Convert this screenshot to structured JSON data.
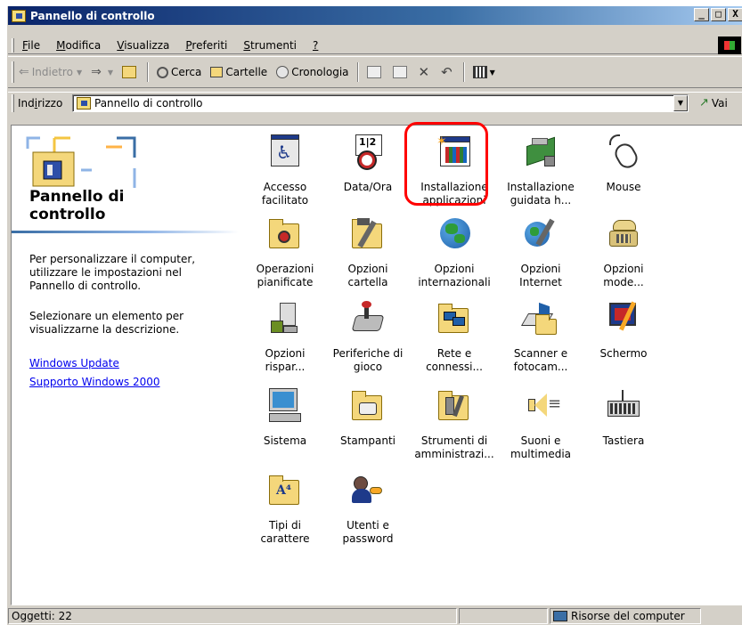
{
  "window": {
    "title": "Pannello di controllo"
  },
  "title_buttons": [
    "_",
    "□",
    "X"
  ],
  "menu": [
    {
      "pre": "",
      "u": "F",
      "post": "ile"
    },
    {
      "pre": "",
      "u": "M",
      "post": "odifica"
    },
    {
      "pre": "",
      "u": "V",
      "post": "isualizza"
    },
    {
      "pre": "",
      "u": "P",
      "post": "referiti"
    },
    {
      "pre": "",
      "u": "S",
      "post": "trumenti"
    },
    {
      "pre": "",
      "u": "?",
      "post": ""
    }
  ],
  "toolbar": {
    "back": "Indietro",
    "search": "Cerca",
    "folders": "Cartelle",
    "history": "Cronologia"
  },
  "address": {
    "label_pre": "Ind",
    "label_u": "i",
    "label_post": "rizzo",
    "value": "Pannello di controllo",
    "go": "Vai"
  },
  "left_pane": {
    "title_line1": "Pannello di",
    "title_line2": "controllo",
    "description": "Per personalizzare il computer, utilizzare le impostazioni nel Pannello di controllo.",
    "hint": "Selezionare un elemento per visualizzarne la descrizione.",
    "links": [
      "Windows Update",
      "Supporto Windows 2000"
    ]
  },
  "items": [
    {
      "label": "Accesso\nfacilitato",
      "icon": "accessibility-icon"
    },
    {
      "label": "Data/Ora",
      "icon": "date-time-icon"
    },
    {
      "label": "Installazione\napplicazioni",
      "icon": "add-remove-programs-icon"
    },
    {
      "label": "Installazione\nguidata h...",
      "icon": "add-hardware-icon"
    },
    {
      "label": "Mouse",
      "icon": "mouse-icon"
    },
    {
      "label": "Operazioni\npianificate",
      "icon": "scheduled-tasks-icon"
    },
    {
      "label": "Opzioni\ncartella",
      "icon": "folder-options-icon"
    },
    {
      "label": "Opzioni\ninternazionali",
      "icon": "globe-icon"
    },
    {
      "label": "Opzioni\nInternet",
      "icon": "internet-options-icon"
    },
    {
      "label": "Opzioni\nmode...",
      "icon": "modem-phone-icon"
    },
    {
      "label": "Opzioni\nrispar...",
      "icon": "power-options-icon"
    },
    {
      "label": "Periferiche di\ngioco",
      "icon": "game-controllers-icon"
    },
    {
      "label": "Rete e\nconnessi...",
      "icon": "network-icon"
    },
    {
      "label": "Scanner e\nfotocam...",
      "icon": "scanner-camera-icon"
    },
    {
      "label": "Schermo",
      "icon": "display-icon"
    },
    {
      "label": "Sistema",
      "icon": "system-computer-icon"
    },
    {
      "label": "Stampanti",
      "icon": "printers-icon"
    },
    {
      "label": "Strumenti di\namministrazi...",
      "icon": "admin-tools-icon"
    },
    {
      "label": "Suoni e\nmultimedia",
      "icon": "speaker-icon"
    },
    {
      "label": "Tastiera",
      "icon": "keyboard-icon"
    },
    {
      "label": "Tipi di\ncarattere",
      "icon": "fonts-icon"
    },
    {
      "label": "Utenti e\npassword",
      "icon": "users-passwords-icon"
    }
  ],
  "status": {
    "count": "Oggetti: 22",
    "location": "Risorse del computer"
  },
  "colors": {
    "title_gradient_start": "#0a246a",
    "link": "#0000ee",
    "highlight": "#ff0000"
  }
}
